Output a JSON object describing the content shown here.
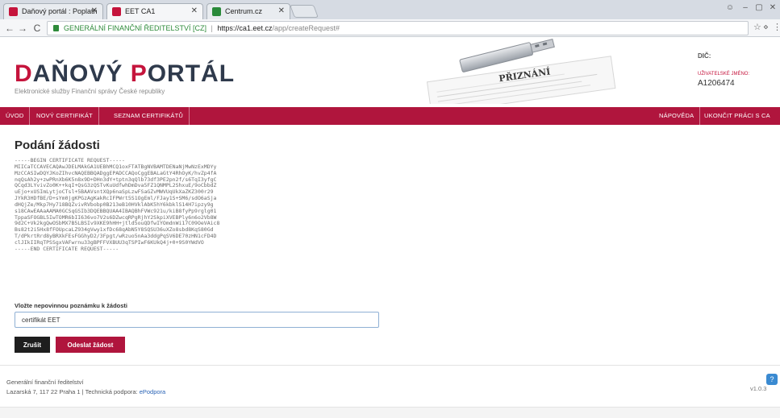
{
  "browser": {
    "tabs": [
      {
        "title": "Daňový portál : Poplatn",
        "favicon_color": "#c5143c",
        "active": false
      },
      {
        "title": "EET CA1",
        "favicon_color": "#c5143c",
        "active": true
      },
      {
        "title": "Centrum.cz",
        "favicon_color": "#2a8a3a",
        "active": false
      }
    ],
    "address": {
      "secure_label": "GENERÁLNÍ FINANČNÍ ŘEDITELSTVÍ [CZ]",
      "url_host": "https://ca1.eet.cz",
      "url_path": "/app/createRequest#"
    }
  },
  "site": {
    "logo_first_letter": "D",
    "logo_text_a": "AŇOVÝ ",
    "logo_second_letter": "P",
    "logo_text_b": "ORTÁL",
    "tagline": "Elektronické služby Finanční správy České republiky",
    "banner_word": "PŘIZNÁNÍ",
    "dic_label": "DIČ:",
    "subject_label": "UŽIVATELSKÉ JMÉNO:",
    "subject_value": "A1206474"
  },
  "nav": {
    "items": [
      {
        "label": "ÚVOD"
      },
      {
        "label": "NOVÝ CERTIFIKÁT"
      },
      {
        "label": "SEZNAM CERTIFIKÁTŮ"
      }
    ],
    "right_items": [
      {
        "label": "NÁPOVĚDA"
      },
      {
        "label": "UKONČIT PRÁCI S CA"
      }
    ]
  },
  "main": {
    "title": "Podání žádosti",
    "csr_lines": [
      "-----BEGIN CERTIFICATE REQUEST-----",
      "MIICaTCCAVECAQAwJDELMAkGA1UEBhMCQ1oxFTATBgNVBAMTDENaNjMwNzExMDYy",
      "MzCCASIwDQYJKoZIhvcNAQEBBQADggEPADCCAQoCggEBALaGtY4RhOyK/hvZp4fA",
      "nqQsAh2y+zwPRnXb6K5n8x9D+DHn3dY+tptn3qQlb73df3PE2pn2f/s6TqI3yfgC",
      "QCqd3LYvivZo0K++kqI+QsG3zQSTvKuUdfwhDmDva5FZ1QNMPL2ShxuE/9oCbbdZ",
      "uEjo+xUSImLytjoCTsl+5BAAVsntXQp6naSpLzwFSaGZvMWVUqUkXaZKZ300r29",
      "JYkR3HDfBE/D+sYm0jgKPGzAgKakRcIFPWrt5S1OgEml/FJay1S+SM6/sdO6aSja",
      "dHQjZe/Mkp7Hy718BQZvivRVbobp0B213eB10HVklAbK5hY6kbklS14H7ipzy9g",
      "s18CAwEAAaAAMA0GCSqGSIb3DQEBBQUAA4IBAQBhFVWc921u/kiB8fyPp9rglg01",
      "TppaSFOGBL5IwTOMR6bII636vo7V2s6DZwcqRPgRjhY2SkpiXVEBPly6n6o2Vb8W",
      "9d2C+Vk2kgQwOSbMX7B5LBSIv9XKE9hHH+jtld5ouQDfwIYOmdnWi17C09OeVAic8",
      "Bs82t2i5Hx8fFOUpcaLZ934gVwy1xfDc68qAbN5Y8SQSU36uXZo8sbd8KqS80Gd",
      "T/dPkrtRrd8yBRXkFEsFGGhyD2/3Fpgt/wRzuo5nAa3ddgPqSV6DE70zHN1cFD4D",
      "clJIkIIRqTPSSgxVAFwrnu33gBPFFVXBUU3qTSPIwF6KUkQ4j+0+9S0YWdVO",
      "-----END CERTIFICATE REQUEST-----"
    ],
    "note_label": "Vložte nepovinnou poznámku k žádosti",
    "note_value": "certifikát EET",
    "cancel_label": "Zrušit",
    "submit_label": "Odeslat žádost"
  },
  "footer": {
    "line1": "Generální finanční ředitelství",
    "line2_prefix": "Lazarská 7, 117 22 Praha 1 | Technická podpora: ",
    "support_link": "ePodpora",
    "version": "v1.0.3"
  },
  "colors": {
    "brand_red": "#b0153d",
    "logo_dark": "#2f3a4c",
    "link_blue": "#2a63b5"
  }
}
